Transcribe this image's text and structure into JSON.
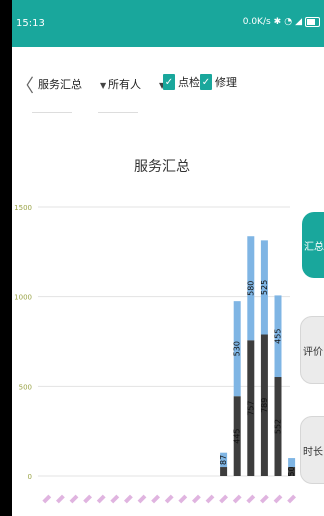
{
  "status": {
    "time": "15:13",
    "speed": "0.0K/s"
  },
  "toolbar": {
    "back": "〈",
    "dropdown1": "服务汇总",
    "dropdown2": "所有人",
    "check1": "点检",
    "check2": "修理",
    "caret": "▼",
    "checkmark": "✓"
  },
  "side_buttons": {
    "summary": "汇总",
    "evaluate": "评价",
    "duration": "时长"
  },
  "colors": {
    "accent": "#19a79c",
    "series_dark": "#3d3d3d",
    "series_light": "#7fb5e4"
  },
  "chart_data": {
    "type": "bar",
    "stacked": true,
    "title": "服务汇总",
    "ylim": [
      0,
      1500
    ],
    "yticks": [
      0,
      500,
      1000,
      1500
    ],
    "grid": true,
    "categories": [
      "",
      "",
      "",
      "",
      "",
      "",
      "",
      "",
      "",
      "",
      "",
      "",
      "",
      "",
      "",
      "",
      "",
      ""
    ],
    "series": [
      {
        "values": [
          0,
          0,
          0,
          0,
          0,
          0,
          0,
          0,
          0,
          0,
          0,
          0,
          0,
          50,
          445,
          757,
          789,
          552,
          50
        ]
      },
      {
        "values": [
          0,
          0,
          0,
          0,
          0,
          0,
          0,
          0,
          0,
          0,
          0,
          0,
          0,
          80,
          530,
          580,
          525,
          455,
          50
        ]
      }
    ],
    "data_labels": [
      [
        "",
        "",
        "",
        "",
        "",
        "",
        "",
        "",
        "",
        "",
        "",
        "",
        "",
        "",
        "445",
        "757",
        "789",
        "552",
        "50"
      ],
      [
        "",
        "",
        "",
        "",
        "",
        "",
        "",
        "",
        "",
        "",
        "",
        "",
        "",
        "87",
        "530",
        "580",
        "525",
        "455",
        ""
      ]
    ]
  }
}
